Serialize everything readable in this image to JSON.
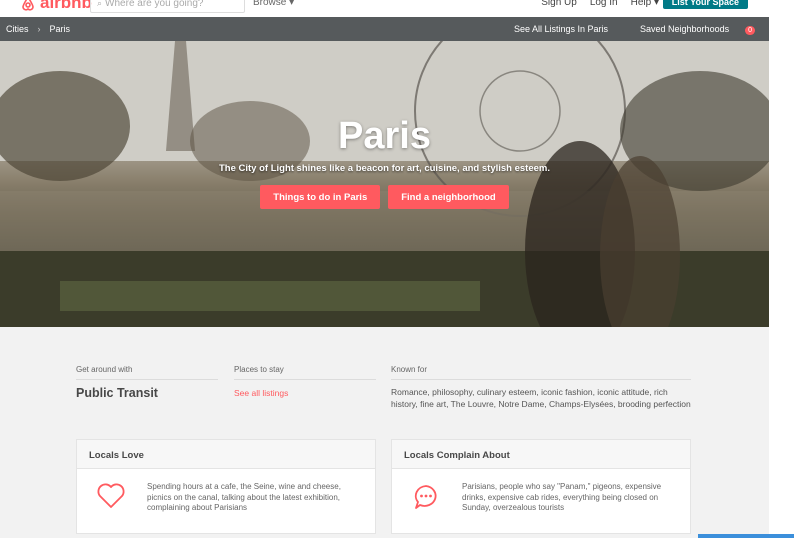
{
  "header": {
    "logo_text": "airbnb",
    "search_placeholder": "Where are you going?",
    "browse_label": "Browse ▾",
    "nav": [
      "Sign Up",
      "Log In",
      "Help ▾"
    ],
    "list_button": "List Your Space"
  },
  "breadcrumb": {
    "items": [
      "Cities",
      "Paris"
    ],
    "see_all": "See All Listings In Paris",
    "saved": "Saved Neighborhoods",
    "saved_count": "0"
  },
  "hero": {
    "title": "Paris",
    "subtitle": "The City of Light shines like a beacon for art, cuisine, and stylish esteem.",
    "btn_things": "Things to do in Paris",
    "btn_neighborhood": "Find a neighborhood"
  },
  "info": {
    "get_around_label": "Get around with",
    "get_around_value": "Public Transit",
    "places_label": "Places to stay",
    "places_link": "See all listings",
    "known_label": "Known for",
    "known_text": "Romance, philosophy, culinary esteem, iconic fashion, iconic attitude, rich history, fine art, The Louvre, Notre Dame, Champs-Elysées, brooding perfection"
  },
  "cards": {
    "love_title": "Locals Love",
    "love_text": "Spending hours at a cafe, the Seine, wine and cheese, picnics on the canal, talking about the latest exhibition, complaining about Parisians",
    "complain_title": "Locals Complain About",
    "complain_text": "Parisians, people who say \"Panam,\" pigeons, expensive drinks, expensive cab rides, everything being closed on Sunday, overzealous tourists"
  },
  "colors": {
    "brand": "#ff5a5f",
    "teal": "#007a87",
    "crumb_bg": "#565a5c"
  }
}
